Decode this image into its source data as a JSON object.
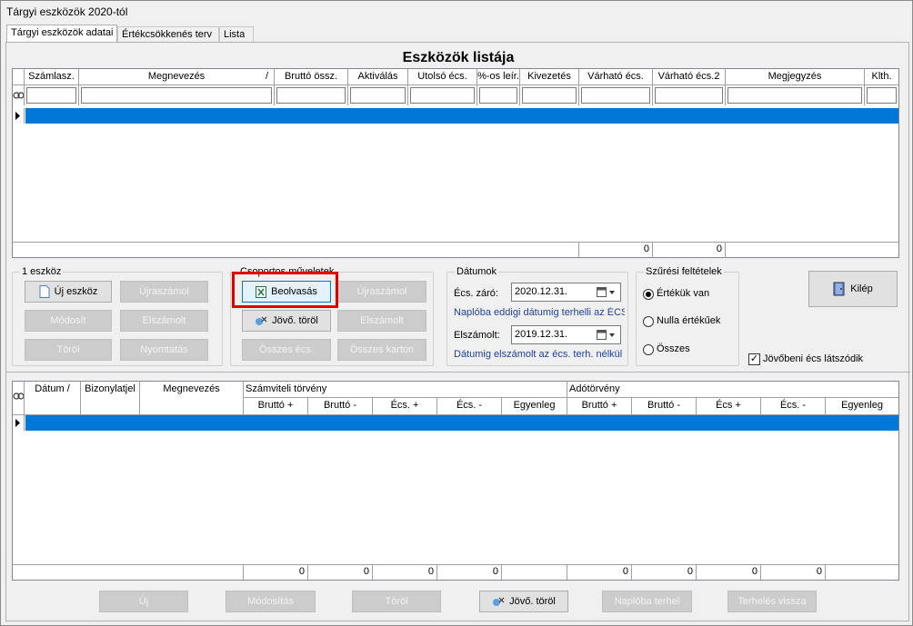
{
  "window": {
    "title": "Tárgyi eszközök 2020-tól"
  },
  "tabs": [
    "Tárgyi eszközök adatai",
    "Értékcsökkenés terv",
    "Lista"
  ],
  "heading": "Eszközök listája",
  "top_grid": {
    "columns": [
      "Számlasz.",
      "Megnevezés",
      "Bruttó össz.",
      "Aktiválás",
      "Utolsó écs.",
      "%-os leír.",
      "Kivezetés",
      "Várható écs.",
      "Várható écs.2",
      "Megjegyzés",
      "Klth."
    ],
    "sort_mark": "/",
    "footer": [
      "0",
      "0"
    ]
  },
  "group1": {
    "title": "1 eszköz",
    "new": "Új eszköz",
    "recalc": "Újraszámol",
    "modify": "Módosít",
    "settled": "Elszámolt",
    "delete": "Töröl",
    "print": "Nyomtatás"
  },
  "group2": {
    "title": "Csoportos műveletek",
    "read": "Beolvasás",
    "recalc": "Újraszámol",
    "future_delete": "Jövő. töröl",
    "settled": "Elszámolt",
    "all_dep": "Összes écs.",
    "all_cards": "Összes karton"
  },
  "dates": {
    "title": "Dátumok",
    "close_label": "Écs. záró:",
    "close_value": "2020.12.31.",
    "close_note": "Naplóba eddigi dátumig terhelli az ÉCS-t",
    "settled_label": "Elszámolt:",
    "settled_value": "2019.12.31.",
    "settled_note": "Dátumig elszámolt az écs. terh. nélkül"
  },
  "filter": {
    "title": "Szűrési feltételek",
    "opt1": "Értékük van",
    "opt2": "Nulla értékűek",
    "opt3": "Összes"
  },
  "exit": "Kilép",
  "future_visible": "Jövőbeni écs látszódik",
  "bottom_grid": {
    "col_date": "Dátum",
    "col_doc": "Bizonylatjel",
    "col_name": "Megnevezés",
    "grp_acc": "Számviteli törvény",
    "grp_tax": "Adótörvény",
    "sub": [
      "Bruttó +",
      "Bruttó -",
      "Écs. +",
      "Écs. -",
      "Egyenleg",
      "Bruttó +",
      "Bruttó -",
      "Écs +",
      "Écs. -",
      "Egyenleg"
    ],
    "footer": [
      "0",
      "0",
      "0",
      "0",
      "0",
      "0",
      "0",
      "0"
    ]
  },
  "bottom_buttons": {
    "new": "Új",
    "modify": "Módosítás",
    "delete": "Töröl",
    "future_delete": "Jövő. töröl",
    "journal": "Naplóba terhel",
    "undo": "Terhelés vissza"
  }
}
